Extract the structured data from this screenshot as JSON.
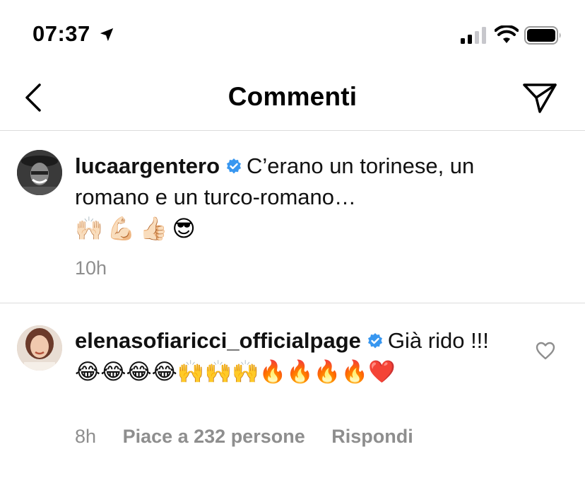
{
  "status_bar": {
    "time": "07:37"
  },
  "nav": {
    "title": "Commenti"
  },
  "caption": {
    "username": "lucaargentero",
    "verified": true,
    "text": "C’erano un torinese, un romano e un turco-romano…",
    "emojis": "🙌🏻💪🏻👍🏻😎",
    "time": "10h"
  },
  "comment": {
    "username": "elenasofiaricci_officialpage",
    "verified": true,
    "text": "Già rido !!!",
    "emojis": "😂😂😂😂🙌🙌🙌🔥🔥🔥🔥❤️",
    "time": "8h",
    "likes": "Piace a 232 persone",
    "reply": "Rispondi"
  },
  "colors": {
    "verified_blue": "#3897f0",
    "meta_gray": "#8e8e8e",
    "divider": "#dbdbdb"
  },
  "icons": [
    "location-arrow-icon",
    "signal-icon",
    "wifi-icon",
    "battery-icon",
    "back-chevron-icon",
    "send-icon",
    "verified-badge-icon",
    "heart-outline-icon"
  ]
}
